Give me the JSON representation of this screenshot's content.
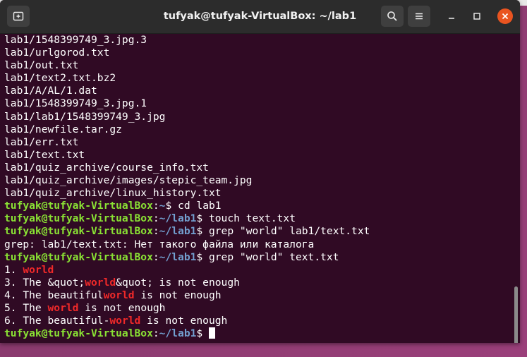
{
  "window": {
    "title": "tufyak@tufyak-VirtualBox: ~/lab1"
  },
  "icons": {
    "new_tab": "new-tab-icon",
    "search": "search-icon",
    "menu": "hamburger-menu-icon",
    "minimize": "minimize-icon",
    "maximize": "maximize-icon",
    "close": "close-icon"
  },
  "colors": {
    "terminal_bg": "#300a24",
    "prompt_user": "#8ae234",
    "prompt_path": "#729fcf",
    "match": "#ef2929",
    "close_button": "#e95420"
  },
  "prompt": {
    "user_host": "tufyak@tufyak-VirtualBox",
    "sep": ":",
    "home_path": "~",
    "lab_path": "~/lab1",
    "dollar": "$"
  },
  "output_before": [
    "lab1/1548399749_3.jpg.3",
    "lab1/urlgorod.txt",
    "lab1/out.txt",
    "lab1/text2.txt.bz2",
    "lab1/A/AL/1.dat",
    "lab1/1548399749_3.jpg.1",
    "lab1/lab1/1548399749_3.jpg",
    "lab1/newfile.tar.gz",
    "lab1/err.txt",
    "lab1/text.txt",
    "lab1/quiz_archive/course_info.txt",
    "lab1/quiz_archive/images/stepic_team.jpg",
    "lab1/quiz_archive/linux_history.txt"
  ],
  "commands": [
    " cd lab1",
    " touch text.txt",
    " grep \"world\" lab1/text.txt",
    " grep \"world\" text.txt"
  ],
  "grep_error": "grep: lab1/text.txt: Нет такого файла или каталога",
  "matches": [
    {
      "pre": "1. ",
      "match": "world",
      "post": ""
    },
    {
      "pre": "3. The &quot;",
      "match": "world",
      "post": "&quot; is not enough"
    },
    {
      "pre": "4. The beautiful",
      "match": "world",
      "post": " is not enough"
    },
    {
      "pre": "5. The ",
      "match": "world",
      "post": " is not enough"
    },
    {
      "pre": "6. The beautiful-",
      "match": "world",
      "post": " is not enough"
    }
  ]
}
